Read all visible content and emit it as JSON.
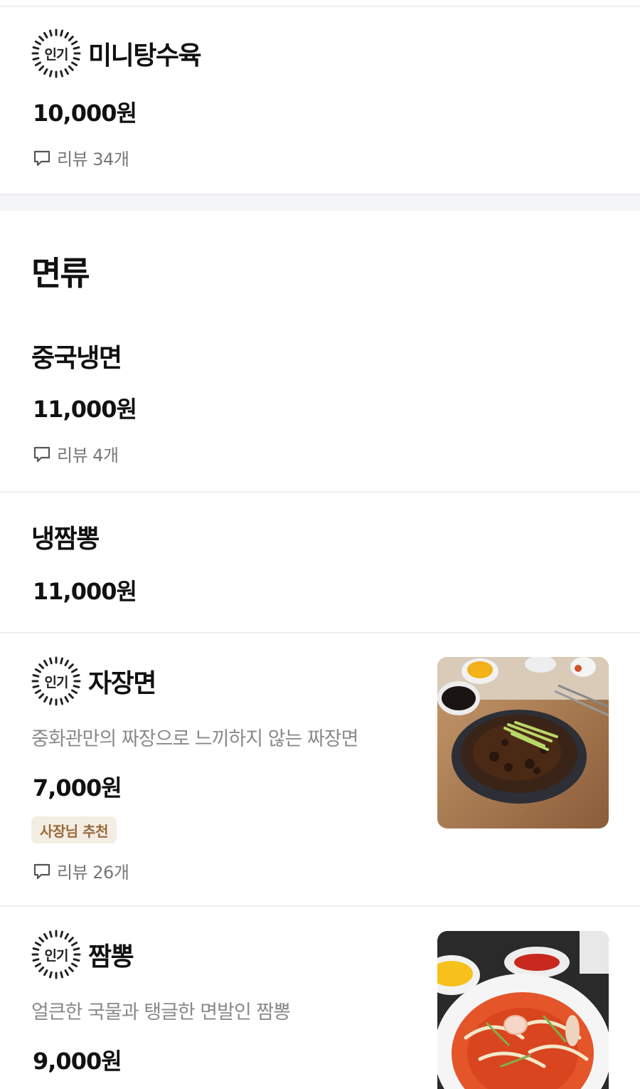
{
  "badges": {
    "popular": "인기"
  },
  "items": {
    "mini_tangsuyuk": {
      "name": "미니탕수육",
      "price": "10,000원",
      "review": "리뷰 34개"
    },
    "chinese_naengmyeon": {
      "name": "중국냉면",
      "price": "11,000원",
      "review": "리뷰 4개"
    },
    "naeng_jjamppong": {
      "name": "냉짬뽕",
      "price": "11,000원"
    },
    "jajangmyeon": {
      "name": "자장면",
      "description": "중화관만의 짜장으로 느끼하지 않는 짜장면",
      "price": "7,000원",
      "tag": "사장님 추천",
      "review": "리뷰 26개",
      "image_icon": "jajangmyeon-photo"
    },
    "jjamppong": {
      "name": "짬뽕",
      "description": "얼큰한 국물과 탱글한 면발인 짬뽕",
      "price": "9,000원",
      "image_icon": "jjamppong-photo"
    }
  },
  "section": {
    "title": "면류"
  },
  "colors": {
    "tag_bg": "#f3ede4",
    "tag_text": "#9a6a3a",
    "divider": "#eeeff1",
    "section_gap": "#f4f5f7"
  }
}
